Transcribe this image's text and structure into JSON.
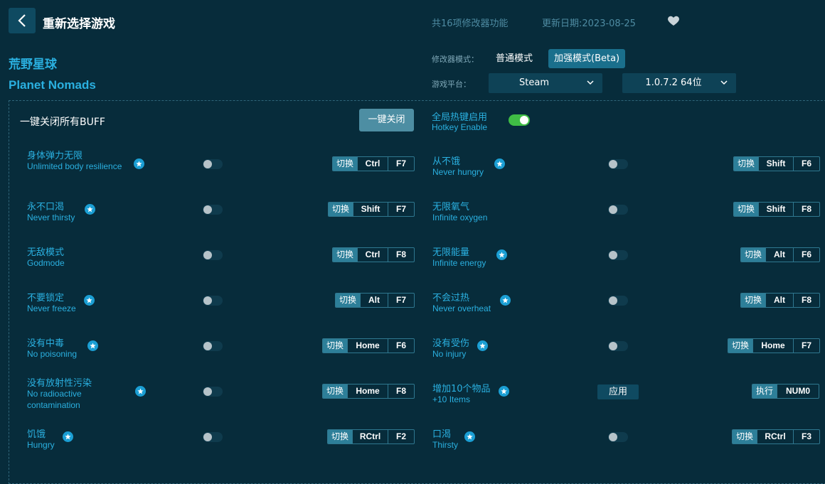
{
  "header": {
    "title": "重新选择游戏",
    "feature_count": "共16项修改器功能",
    "update_date": "更新日期:2023-08-25"
  },
  "game": {
    "name_cn": "荒野星球",
    "name_en": "Planet Nomads"
  },
  "mode": {
    "label": "修改器模式：",
    "normal": "普通模式",
    "beta": "加强模式(Beta)",
    "selected": "加强模式(Beta)"
  },
  "platform": {
    "label": "游戏平台：",
    "value": "Steam",
    "version": "1.0.7.2 64位"
  },
  "controls": {
    "off_all_label": "一键关闭所有BUFF",
    "off_all_button": "一键关闭",
    "hotkey_cn": "全局热键启用",
    "hotkey_en": "Hotkey Enable",
    "hotkey_enabled": true
  },
  "cheats_left": [
    {
      "cn": "身体弹力无限",
      "en": "Unlimited body resilience",
      "star": true,
      "type": "切换",
      "keys": [
        "Ctrl",
        "F7"
      ]
    },
    {
      "cn": "永不口渴",
      "en": "Never thirsty",
      "star": true,
      "type": "切换",
      "keys": [
        "Shift",
        "F7"
      ]
    },
    {
      "cn": "无敌模式",
      "en": "Godmode",
      "star": false,
      "type": "切换",
      "keys": [
        "Ctrl",
        "F8"
      ]
    },
    {
      "cn": "不要锁定",
      "en": "Never freeze",
      "star": true,
      "type": "切换",
      "keys": [
        "Alt",
        "F7"
      ]
    },
    {
      "cn": "没有中毒",
      "en": "No poisoning",
      "star": true,
      "type": "切换",
      "keys": [
        "Home",
        "F6"
      ]
    },
    {
      "cn": "没有放射性污染",
      "en": "No radioactive contamination",
      "star": true,
      "type": "切换",
      "keys": [
        "Home",
        "F8"
      ]
    },
    {
      "cn": "饥饿",
      "en": "Hungry",
      "star": true,
      "type": "切换",
      "keys": [
        "RCtrl",
        "F2"
      ]
    }
  ],
  "cheats_right": [
    {
      "cn": "从不饿",
      "en": "Never hungry",
      "star": true,
      "type": "切换",
      "keys": [
        "Shift",
        "F6"
      ]
    },
    {
      "cn": "无限氧气",
      "en": "Infinite oxygen",
      "star": false,
      "type": "切换",
      "keys": [
        "Shift",
        "F8"
      ]
    },
    {
      "cn": "无限能量",
      "en": "Infinite energy",
      "star": true,
      "type": "切换",
      "keys": [
        "Alt",
        "F6"
      ]
    },
    {
      "cn": "不会过热",
      "en": "Never overheat",
      "star": true,
      "type": "切换",
      "keys": [
        "Alt",
        "F8"
      ]
    },
    {
      "cn": "没有受伤",
      "en": "No injury",
      "star": true,
      "type": "切换",
      "keys": [
        "Home",
        "F7"
      ]
    },
    {
      "cn": "增加10个物品",
      "en": "+10 Items",
      "star": true,
      "type": "执行",
      "keys": [
        "NUM0"
      ],
      "apply": "应用"
    },
    {
      "cn": "口渴",
      "en": "Thirsty",
      "star": true,
      "type": "切换",
      "keys": [
        "RCtrl",
        "F3"
      ]
    }
  ],
  "colors": {
    "background": "#072c3b",
    "accent": "#2ab0e0",
    "toggle_on": "#3fbd45"
  }
}
